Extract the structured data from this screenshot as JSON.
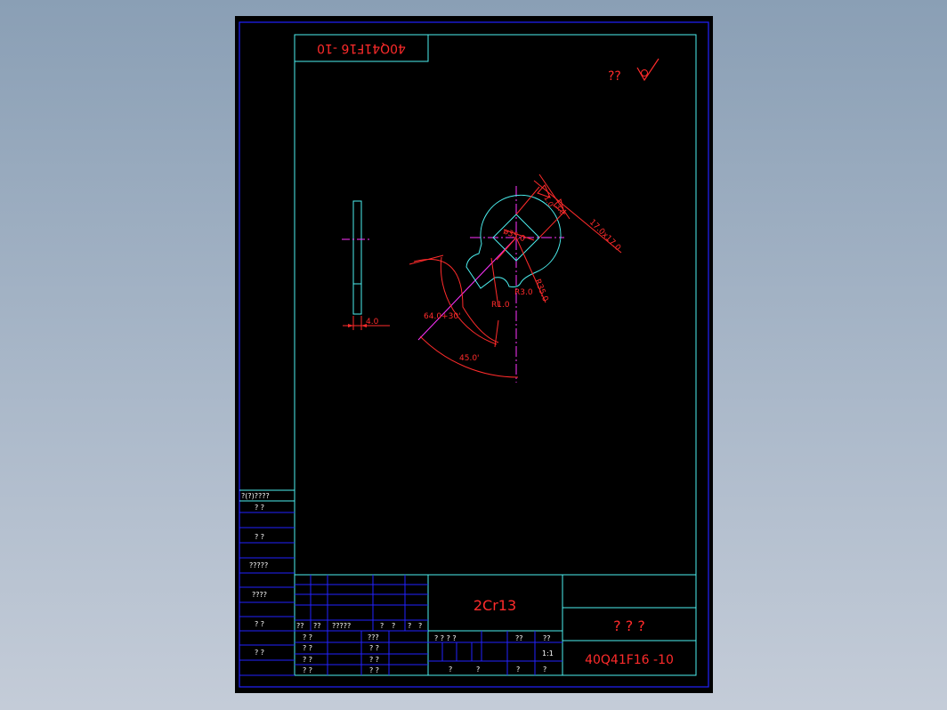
{
  "drawing": {
    "code_rotated": "40Q41F16  -10",
    "roughness_text": "??",
    "part_material": "2Cr13",
    "part_name": "? ? ?",
    "part_code": "40Q41F16  -10",
    "scale": "1:1"
  },
  "dimensions": {
    "thickness": "4.0",
    "bore": "ø35.0",
    "square": "17.0x17.0",
    "chamfer_a": "1.0",
    "chamfer_b": "3.0",
    "r35": "R35.0",
    "r3": "R3.0",
    "r1": "R1.0",
    "arc_radius": "64.0",
    "arc_tolerance": "+30'",
    "angle": "45.0'"
  },
  "side_panel": {
    "header": "?(?)????",
    "rows": [
      "?    ?",
      "?    ?",
      "?????",
      "????",
      "?    ?",
      "?    ?"
    ]
  },
  "title_block": {
    "rev_labels": [
      "??",
      "??",
      "?????",
      "?",
      "?",
      "?",
      "?"
    ],
    "sign_rows": [
      "?  ?",
      "?  ?",
      "?  ?",
      "?  ?"
    ],
    "sign_cols": [
      "???",
      "?  ?",
      "?  ?",
      "?  ?"
    ],
    "stage_row": [
      "?  ?  ?  ?",
      "??",
      "??"
    ],
    "bottom_row": [
      "?",
      "?",
      "?",
      "?"
    ]
  },
  "colors": {
    "sheet": "#000000",
    "border_blue": "#2222ff",
    "frame_cyan": "#4cf0f0",
    "dimension_red": "#ff2b2b",
    "centerline_magenta": "#ff33ff",
    "text_white": "#ffffff"
  }
}
